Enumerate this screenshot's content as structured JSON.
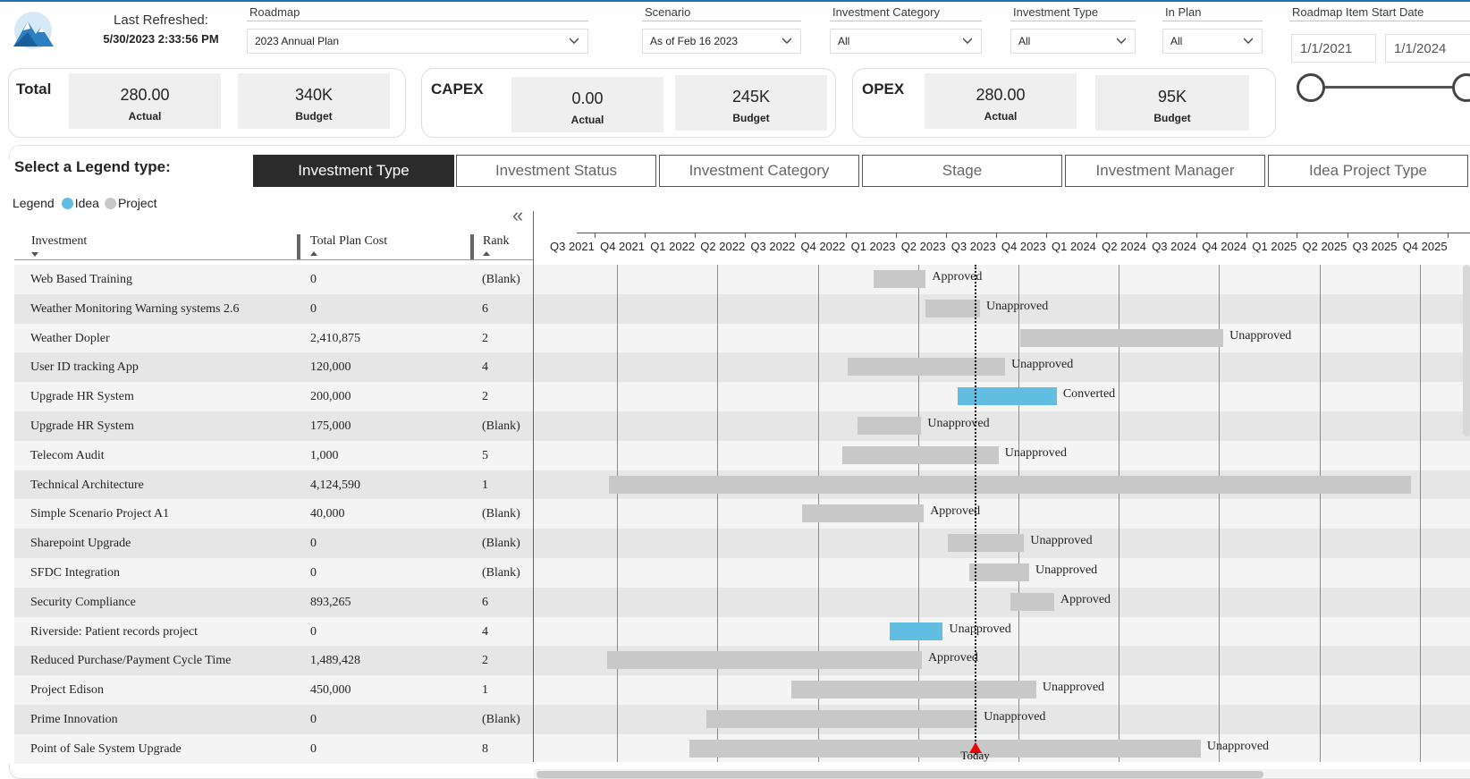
{
  "header": {
    "refresh_label": "Last Refreshed:",
    "refresh_value": "5/30/2023 2:33:56 PM"
  },
  "slicers": {
    "roadmap": {
      "title": "Roadmap",
      "value": "2023 Annual Plan"
    },
    "scenario": {
      "title": "Scenario",
      "value": "As of Feb 16 2023"
    },
    "investment_category": {
      "title": "Investment Category",
      "value": "All"
    },
    "investment_type": {
      "title": "Investment Type",
      "value": "All"
    },
    "in_plan": {
      "title": "In Plan",
      "value": "All"
    },
    "start_date": {
      "title": "Roadmap Item Start Date",
      "from": "1/1/2021",
      "to": "1/1/2024"
    }
  },
  "kpis": {
    "total": {
      "label": "Total",
      "actual": "280.00",
      "actual_label": "Actual",
      "budget": "340K",
      "budget_label": "Budget"
    },
    "capex": {
      "label": "CAPEX",
      "actual": "0.00",
      "actual_label": "Actual",
      "budget": "245K",
      "budget_label": "Budget"
    },
    "opex": {
      "label": "OPEX",
      "actual": "280.00",
      "actual_label": "Actual",
      "budget": "95K",
      "budget_label": "Budget"
    }
  },
  "legend_selector": {
    "label": "Select a Legend type:",
    "buttons": [
      "Investment Type",
      "Investment Status",
      "Investment Category",
      "Stage",
      "Investment Manager",
      "Idea Project Type"
    ],
    "active": "Investment Type"
  },
  "legend": {
    "label": "Legend",
    "items": [
      {
        "name": "Idea",
        "color": "#62bde3"
      },
      {
        "name": "Project",
        "color": "#c8c8c8"
      }
    ]
  },
  "table": {
    "collapse_icon": "«",
    "headers": [
      "Investment",
      "Total Plan Cost",
      "Rank"
    ],
    "rows": [
      [
        "Web Based Training",
        "0",
        "(Blank)"
      ],
      [
        "Weather Monitoring Warning systems 2.6",
        "0",
        "6"
      ],
      [
        "Weather Dopler",
        "2,410,875",
        "2"
      ],
      [
        "User ID tracking App",
        "120,000",
        "4"
      ],
      [
        "Upgrade HR System",
        "200,000",
        "2"
      ],
      [
        "Upgrade HR System",
        "175,000",
        "(Blank)"
      ],
      [
        "Telecom Audit",
        "1,000",
        "5"
      ],
      [
        "Technical Architecture",
        "4,124,590",
        "1"
      ],
      [
        "Simple Scenario Project A1",
        "40,000",
        "(Blank)"
      ],
      [
        "Sharepoint Upgrade",
        "0",
        "(Blank)"
      ],
      [
        "SFDC Integration",
        "0",
        "(Blank)"
      ],
      [
        "Security Compliance",
        "893,265",
        "6"
      ],
      [
        "Riverside: Patient records project",
        "0",
        "4"
      ],
      [
        "Reduced Purchase/Payment Cycle Time",
        "1,489,428",
        "2"
      ],
      [
        "Project Edison",
        "450,000",
        "1"
      ],
      [
        "Prime Innovation",
        "0",
        "(Blank)"
      ],
      [
        "Point of Sale System Upgrade",
        "0",
        "8"
      ]
    ]
  },
  "chart_data": {
    "type": "gantt",
    "x_axis_ticks": [
      "Q3 2021",
      "Q4 2021",
      "Q1 2022",
      "Q2 2022",
      "Q3 2022",
      "Q4 2022",
      "Q1 2023",
      "Q2 2023",
      "Q3 2023",
      "Q4 2023",
      "Q1 2024",
      "Q2 2024",
      "Q3 2024",
      "Q4 2024",
      "Q1 2025",
      "Q2 2025",
      "Q3 2025",
      "Q4 2025"
    ],
    "x_range_quarter_index": [
      0,
      18
    ],
    "today": {
      "label": "Today",
      "quarter_pos": 8.1
    },
    "tasks": [
      {
        "name": "Web Based Training",
        "start": 6.08,
        "end": 7.12,
        "type": "Project",
        "status": "Approved"
      },
      {
        "name": "Weather Monitoring Warning systems 2.6",
        "start": 7.12,
        "end": 8.2,
        "type": "Project",
        "status": "Unapproved"
      },
      {
        "name": "Weather Dopler",
        "start": 9.0,
        "end": 13.05,
        "type": "Project",
        "status": "Unapproved"
      },
      {
        "name": "User ID tracking App",
        "start": 5.57,
        "end": 8.7,
        "type": "Project",
        "status": "Unapproved"
      },
      {
        "name": "Upgrade HR System",
        "start": 7.75,
        "end": 9.73,
        "type": "Idea",
        "status": "Converted"
      },
      {
        "name": "Upgrade HR System",
        "start": 5.75,
        "end": 7.03,
        "type": "Project",
        "status": "Unapproved"
      },
      {
        "name": "Telecom Audit",
        "start": 5.45,
        "end": 8.57,
        "type": "Project",
        "status": "Unapproved"
      },
      {
        "name": "Technical Architecture",
        "start": 0.8,
        "end": 16.8,
        "type": "Project",
        "status": ""
      },
      {
        "name": "Simple Scenario Project A1",
        "start": 4.66,
        "end": 7.08,
        "type": "Project",
        "status": "Approved"
      },
      {
        "name": "Sharepoint Upgrade",
        "start": 7.55,
        "end": 9.08,
        "type": "Project",
        "status": "Unapproved"
      },
      {
        "name": "SFDC Integration",
        "start": 7.98,
        "end": 9.18,
        "type": "Project",
        "status": "Unapproved"
      },
      {
        "name": "Security Compliance",
        "start": 8.8,
        "end": 9.68,
        "type": "Project",
        "status": "Approved"
      },
      {
        "name": "Riverside: Patient records project",
        "start": 6.4,
        "end": 7.46,
        "type": "Idea",
        "status": "Unapproved"
      },
      {
        "name": "Reduced Purchase/Payment Cycle Time",
        "start": 0.77,
        "end": 7.04,
        "type": "Project",
        "status": "Approved"
      },
      {
        "name": "Project Edison",
        "start": 4.43,
        "end": 9.32,
        "type": "Project",
        "status": "Unapproved"
      },
      {
        "name": "Prime Innovation",
        "start": 2.75,
        "end": 8.15,
        "type": "Project",
        "status": "Unapproved"
      },
      {
        "name": "Point of Sale System Upgrade",
        "start": 2.4,
        "end": 12.6,
        "type": "Project",
        "status": "Unapproved"
      }
    ]
  }
}
